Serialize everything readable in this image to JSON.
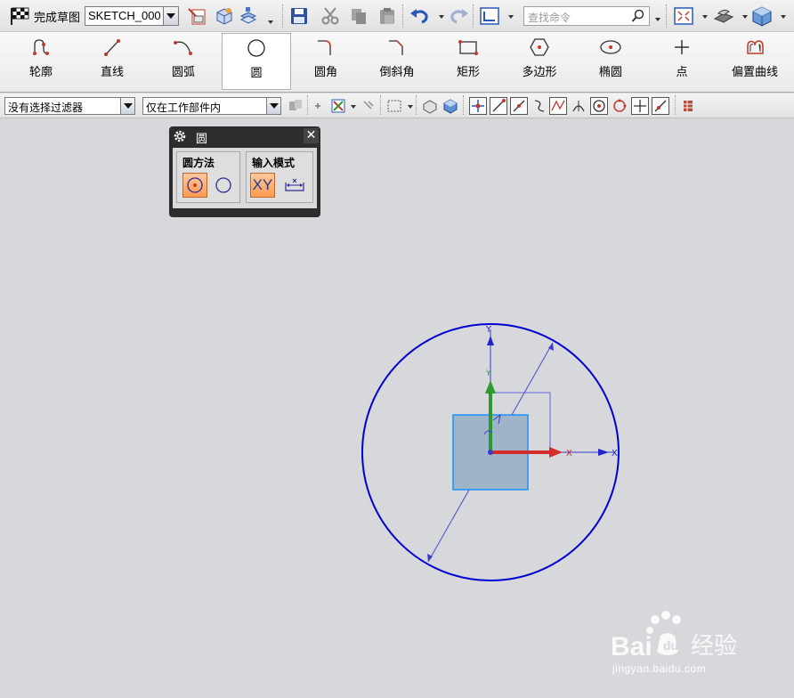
{
  "toolbar": {
    "finish_sketch_label": "完成草图",
    "sketch_name": "SKETCH_000",
    "search_placeholder": "查找命令"
  },
  "ribbon": {
    "items": [
      {
        "label": "轮廓",
        "icon": "profile-icon"
      },
      {
        "label": "直线",
        "icon": "line-icon"
      },
      {
        "label": "圆弧",
        "icon": "arc-icon"
      },
      {
        "label": "圆",
        "icon": "circle-icon",
        "active": true
      },
      {
        "label": "圆角",
        "icon": "fillet-icon"
      },
      {
        "label": "倒斜角",
        "icon": "chamfer-icon"
      },
      {
        "label": "矩形",
        "icon": "rectangle-icon"
      },
      {
        "label": "多边形",
        "icon": "polygon-icon"
      },
      {
        "label": "椭圆",
        "icon": "ellipse-icon"
      },
      {
        "label": "点",
        "icon": "point-icon"
      },
      {
        "label": "偏置曲线",
        "icon": "offset-curve-icon"
      }
    ]
  },
  "filterbar": {
    "selection_filter": "没有选择过滤器",
    "scope_filter": "仅在工作部件内"
  },
  "dialog": {
    "title": "圆",
    "method_group_label": "圆方法",
    "input_mode_group_label": "输入模式",
    "xy_label": "XY"
  },
  "canvas": {
    "y_axis_label": "Y",
    "x_axis_label": "X",
    "y_small_label": "Y",
    "x_small_label": "X"
  },
  "watermark": {
    "brand": "Baidu经验",
    "url": "jingyan.baidu.com"
  },
  "colors": {
    "accent_orange": "#ff9a50",
    "sketch_blue": "#0000cc",
    "axis_green": "#2e9a2e",
    "axis_red": "#d22c2c",
    "background": "#d6d8db"
  }
}
